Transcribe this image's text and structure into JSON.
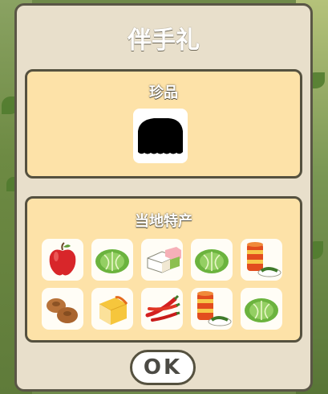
{
  "dialog": {
    "title": "伴手礼",
    "ok_label": "OK"
  },
  "rare_section": {
    "label": "珍品",
    "items": [
      {
        "icon": "unknown-silhouette-icon"
      }
    ]
  },
  "local_section": {
    "label": "当地特产",
    "items": [
      {
        "icon": "apple-icon"
      },
      {
        "icon": "cabbage-icon"
      },
      {
        "icon": "dessert-icon"
      },
      {
        "icon": "cabbage-icon"
      },
      {
        "icon": "canned-food-icon"
      },
      {
        "icon": "bun-icon"
      },
      {
        "icon": "cheese-icon"
      },
      {
        "icon": "chili-pepper-icon"
      },
      {
        "icon": "canned-food-icon"
      },
      {
        "icon": "cabbage-icon"
      }
    ]
  },
  "colors": {
    "panel_bg": "#e8dfcb",
    "section_bg": "#fde2a8",
    "border": "#55513f"
  }
}
